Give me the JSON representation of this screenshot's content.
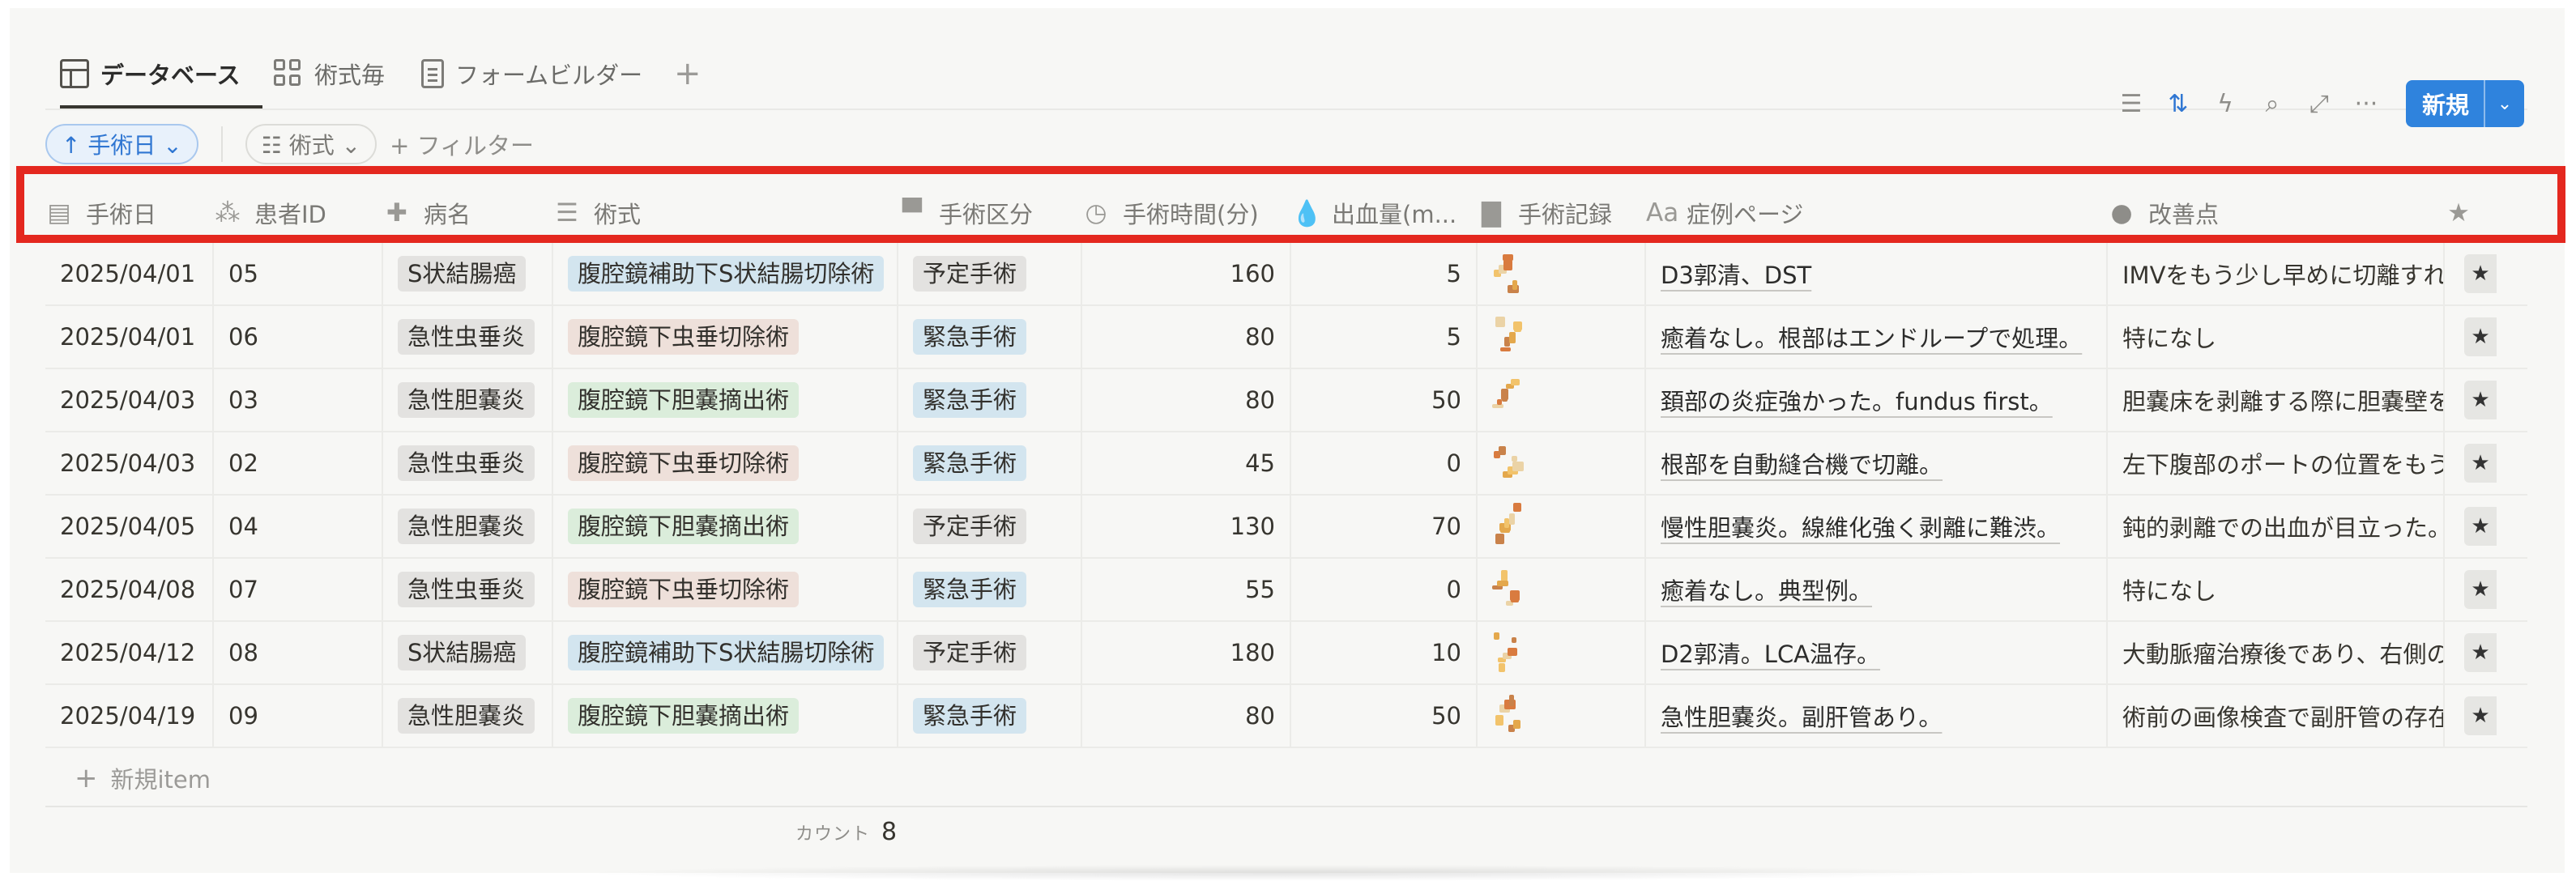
{
  "tabs": [
    {
      "label": "データベース",
      "icon": "table-icon",
      "active": true
    },
    {
      "label": "術式毎",
      "icon": "grid-icon",
      "active": false
    },
    {
      "label": "フォームビルダー",
      "icon": "document-icon",
      "active": false
    }
  ],
  "add_tab_label": "+",
  "toolbar": {
    "filter_icon": "☰",
    "sort_icon": "⇅",
    "automation_icon": "ϟ",
    "search_icon": "⌕",
    "expand_icon": "⤢",
    "more_icon": "···",
    "new_label": "新規",
    "new_dropdown": "⌄",
    "accent": "#2f83dd"
  },
  "filters": {
    "sort_chip": "↑ 手術日 ⌄",
    "group_chip": "☷ 術式 ⌄",
    "add_filter": "+ フィルター"
  },
  "columns": [
    {
      "label": "手術日",
      "icon": "▤"
    },
    {
      "label": "患者ID",
      "icon": "⁂"
    },
    {
      "label": "病名",
      "icon": "✚"
    },
    {
      "label": "術式",
      "icon": "☰"
    },
    {
      "label": "手術区分",
      "icon": "▀"
    },
    {
      "label": "手術時間(分)",
      "icon": "◷"
    },
    {
      "label": "出血量(m...",
      "icon": "💧"
    },
    {
      "label": "手術記録",
      "icon": "▇"
    },
    {
      "label": "症例ページ",
      "icon": "Aa"
    },
    {
      "label": "改善点",
      "icon": "●"
    },
    {
      "label": "",
      "icon": "★"
    }
  ],
  "rows": [
    {
      "date": "2025/04/01",
      "pid": "05",
      "disease": "S状結腸癌",
      "disease_tag": "gray",
      "procedure": "腹腔鏡補助下S状結腸切除術",
      "procedure_tag": "blue",
      "category": "予定手術",
      "category_tag": "gray",
      "time": "160",
      "blood": "5",
      "case": "D3郭清、DST",
      "improve": "IMVをもう少し早めに切離すれば"
    },
    {
      "date": "2025/04/01",
      "pid": "06",
      "disease": "急性虫垂炎",
      "disease_tag": "gray",
      "procedure": "腹腔鏡下虫垂切除術",
      "procedure_tag": "brown",
      "category": "緊急手術",
      "category_tag": "blue",
      "time": "80",
      "blood": "5",
      "case": "癒着なし。根部はエンドループで処理。",
      "improve": "特になし"
    },
    {
      "date": "2025/04/03",
      "pid": "03",
      "disease": "急性胆嚢炎",
      "disease_tag": "gray",
      "procedure": "腹腔鏡下胆嚢摘出術",
      "procedure_tag": "green",
      "category": "緊急手術",
      "category_tag": "blue",
      "time": "80",
      "blood": "50",
      "case": "頚部の炎症強かった。fundus first。",
      "improve": "胆嚢床を剥離する際に胆嚢壁を"
    },
    {
      "date": "2025/04/03",
      "pid": "02",
      "disease": "急性虫垂炎",
      "disease_tag": "gray",
      "procedure": "腹腔鏡下虫垂切除術",
      "procedure_tag": "brown",
      "category": "緊急手術",
      "category_tag": "blue",
      "time": "45",
      "blood": "0",
      "case": "根部を自動縫合機で切離。",
      "improve": "左下腹部のポートの位置をもう少"
    },
    {
      "date": "2025/04/05",
      "pid": "04",
      "disease": "急性胆嚢炎",
      "disease_tag": "gray",
      "procedure": "腹腔鏡下胆嚢摘出術",
      "procedure_tag": "green",
      "category": "予定手術",
      "category_tag": "gray",
      "time": "130",
      "blood": "70",
      "case": "慢性胆嚢炎。線維化強く剥離に難渋。",
      "improve": "鈍的剥離での出血が目立った。"
    },
    {
      "date": "2025/04/08",
      "pid": "07",
      "disease": "急性虫垂炎",
      "disease_tag": "gray",
      "procedure": "腹腔鏡下虫垂切除術",
      "procedure_tag": "brown",
      "category": "緊急手術",
      "category_tag": "blue",
      "time": "55",
      "blood": "0",
      "case": "癒着なし。典型例。",
      "improve": "特になし"
    },
    {
      "date": "2025/04/12",
      "pid": "08",
      "disease": "S状結腸癌",
      "disease_tag": "gray",
      "procedure": "腹腔鏡補助下S状結腸切除術",
      "procedure_tag": "blue",
      "category": "予定手術",
      "category_tag": "gray",
      "time": "180",
      "blood": "10",
      "case": "D2郭清。LCA温存。",
      "improve": "大動脈瘤治療後であり、右側の"
    },
    {
      "date": "2025/04/19",
      "pid": "09",
      "disease": "急性胆嚢炎",
      "disease_tag": "gray",
      "procedure": "腹腔鏡下胆嚢摘出術",
      "procedure_tag": "green",
      "category": "緊急手術",
      "category_tag": "blue",
      "time": "80",
      "blood": "50",
      "case": "急性胆嚢炎。副肝管あり。",
      "improve": "術前の画像検査で副肝管の存在"
    }
  ],
  "new_item_plus": "+",
  "new_item_label": "新規item",
  "count_label": "カウント",
  "count_value": "8",
  "highlight_color": "#e4281f"
}
